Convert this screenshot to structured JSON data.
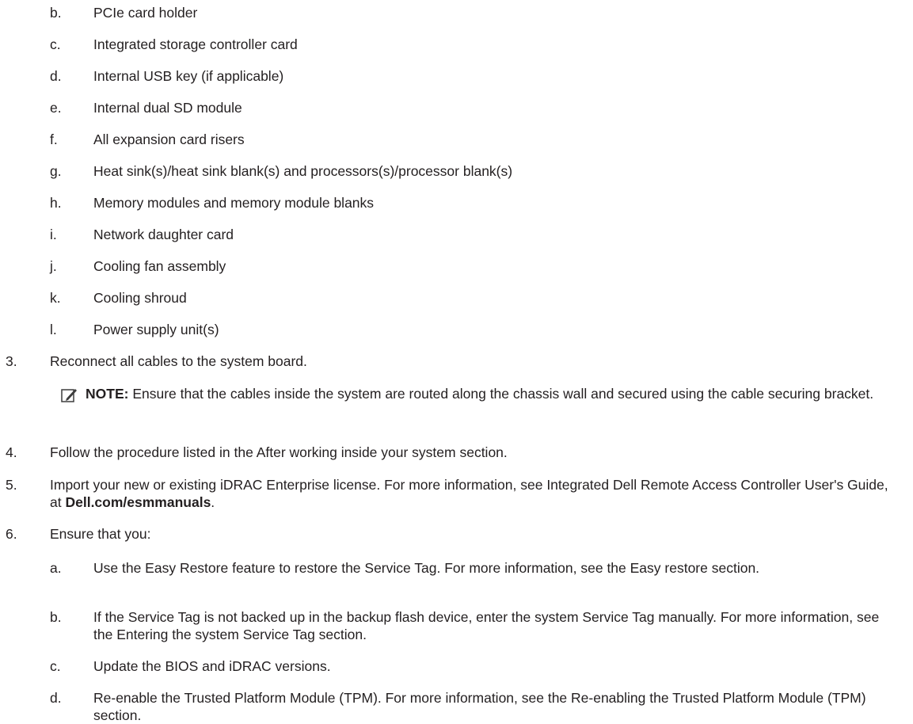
{
  "sublist_top": [
    {
      "marker": "b.",
      "text": "PCIe card holder"
    },
    {
      "marker": "c.",
      "text": "Integrated storage controller card"
    },
    {
      "marker": "d.",
      "text": "Internal USB key (if applicable)"
    },
    {
      "marker": "e.",
      "text": "Internal dual SD module"
    },
    {
      "marker": "f.",
      "text": "All expansion card risers"
    },
    {
      "marker": "g.",
      "text": "Heat sink(s)/heat sink blank(s) and processors(s)/processor blank(s)"
    },
    {
      "marker": "h.",
      "text": "Memory modules and memory module blanks"
    },
    {
      "marker": "i.",
      "text": "Network daughter card"
    },
    {
      "marker": "j.",
      "text": "Cooling fan assembly"
    },
    {
      "marker": "k.",
      "text": "Cooling shroud"
    },
    {
      "marker": "l.",
      "text": "Power supply unit(s)"
    }
  ],
  "step3": {
    "marker": "3.",
    "text": "Reconnect all cables to the system board."
  },
  "note": {
    "icon": "pencil-note-icon",
    "label": "NOTE:",
    "text": " Ensure that the cables inside the system are routed along the chassis wall and secured using the cable securing bracket."
  },
  "step4": {
    "marker": "4.",
    "text": "Follow the procedure listed in the After working inside your system section."
  },
  "step5": {
    "marker": "5.",
    "text_before": "Import your new or existing iDRAC Enterprise license. For more information, see Integrated Dell Remote Access Controller User's Guide, at ",
    "link": "Dell.com/esmmanuals",
    "text_after": "."
  },
  "step6": {
    "marker": "6.",
    "text": "Ensure that you:"
  },
  "sublist_bottom": [
    {
      "marker": "a.",
      "text": "Use the Easy Restore feature to restore the Service Tag. For more information, see the Easy restore section."
    },
    {
      "marker": "b.",
      "text": "If the Service Tag is not backed up in the backup flash device, enter the system Service Tag manually. For more information, see the Entering the system Service Tag section."
    },
    {
      "marker": "c.",
      "text": "Update the BIOS and iDRAC versions."
    },
    {
      "marker": "d.",
      "text": "Re-enable the Trusted Platform Module (TPM). For more information, see the Re-enabling the Trusted Platform Module (TPM) section."
    }
  ]
}
